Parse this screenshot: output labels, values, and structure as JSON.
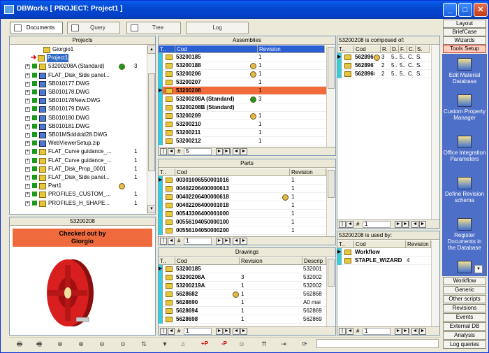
{
  "window": {
    "title": "DBWorks [ PROJECT: Project1 ]",
    "min": "_",
    "max": "□",
    "close": "✕"
  },
  "tabs": [
    {
      "label": "Documents",
      "active": true
    },
    {
      "label": "Query",
      "active": false
    },
    {
      "label": "Tree",
      "active": false
    },
    {
      "label": "Log",
      "active": false
    }
  ],
  "projects": {
    "header": "Projects",
    "tree": [
      {
        "label": "Giorgio1",
        "icon": "folder-icon",
        "level": 0,
        "count": "",
        "status": ""
      },
      {
        "label": "Project1",
        "icon": "folder-icon",
        "level": 0,
        "count": "",
        "status": "",
        "selected": true
      },
      {
        "label": "53200208A (Standard)",
        "icon": "assembly-icon",
        "level": 1,
        "count": "3",
        "status": "green"
      },
      {
        "label": "FLAT_Disk_Side panel...",
        "icon": "document-icon",
        "level": 1,
        "count": "",
        "status": ""
      },
      {
        "label": "SB010177.DWG",
        "icon": "drawing-icon",
        "level": 1,
        "count": "",
        "status": ""
      },
      {
        "label": "SB010178.DWG",
        "icon": "drawing-icon",
        "level": 1,
        "count": "",
        "status": ""
      },
      {
        "label": "SB010178New.DWG",
        "icon": "drawing-icon",
        "level": 1,
        "count": "",
        "status": ""
      },
      {
        "label": "SB010179.DWG",
        "icon": "drawing-icon",
        "level": 1,
        "count": "",
        "status": ""
      },
      {
        "label": "SB010180.DWG",
        "icon": "drawing-icon",
        "level": 1,
        "count": "",
        "status": ""
      },
      {
        "label": "SB010181.DWG",
        "icon": "drawing-icon",
        "level": 1,
        "count": "",
        "status": ""
      },
      {
        "label": "SB01MSddddd28.DWG",
        "icon": "drawing-icon",
        "level": 1,
        "count": "",
        "status": ""
      },
      {
        "label": "WebViewerSetup.zip",
        "icon": "zip-icon",
        "level": 1,
        "count": "",
        "status": ""
      },
      {
        "label": "FLAT_Curve guidance_...",
        "icon": "part-icon",
        "level": 1,
        "count": "1",
        "status": ""
      },
      {
        "label": "FLAT_Curve guidance_...",
        "icon": "part-icon",
        "level": 1,
        "count": "1",
        "status": ""
      },
      {
        "label": "FLAT_Disk_Prop_0001",
        "icon": "part-icon",
        "level": 1,
        "count": "1",
        "status": ""
      },
      {
        "label": "FLAT_Disk_Side panel...",
        "icon": "part-icon",
        "level": 1,
        "count": "1",
        "status": ""
      },
      {
        "label": "Part1",
        "icon": "part-icon",
        "level": 1,
        "count": "",
        "status": "orange"
      },
      {
        "label": "PROFILES_CUSTOM_...",
        "icon": "part-icon",
        "level": 1,
        "count": "1",
        "status": ""
      },
      {
        "label": "PROFILES_H_SHAPE...",
        "icon": "part-icon",
        "level": 1,
        "count": "1",
        "status": ""
      }
    ]
  },
  "preview": {
    "header": "53200208",
    "checked_out": "Checked out by\nGiorgio"
  },
  "assemblies": {
    "header": "Assemblies",
    "columns": [
      "T..",
      "Cod",
      "Revision"
    ],
    "rows": [
      {
        "cod": "53200185",
        "rev": "1",
        "status": ""
      },
      {
        "cod": "53200188",
        "rev": "1",
        "status": "orange"
      },
      {
        "cod": "53200206",
        "rev": "1",
        "status": "orange"
      },
      {
        "cod": "53200207",
        "rev": "1",
        "status": ""
      },
      {
        "cod": "53200208",
        "rev": "1",
        "status": "",
        "selected": true
      },
      {
        "cod": "53200208A (Standard)",
        "rev": "3",
        "status": "green"
      },
      {
        "cod": "53200208B (Standard)",
        "rev": "",
        "status": ""
      },
      {
        "cod": "53200209",
        "rev": "1",
        "status": "orange"
      },
      {
        "cod": "53200210",
        "rev": "1",
        "status": ""
      },
      {
        "cod": "53200211",
        "rev": "1",
        "status": ""
      },
      {
        "cod": "53200212",
        "rev": "1",
        "status": ""
      }
    ],
    "nav_count": "5"
  },
  "parts": {
    "header": "Parts",
    "columns": [
      "T..",
      "Cod",
      "Revision"
    ],
    "rows": [
      {
        "cod": "00301006550001016",
        "rev": "1",
        "status": ""
      },
      {
        "cod": "00402206400000613",
        "rev": "1",
        "status": ""
      },
      {
        "cod": "00402206400000618",
        "rev": "1",
        "status": "orange"
      },
      {
        "cod": "00402206400001018",
        "rev": "1",
        "status": ""
      },
      {
        "cod": "00543306400001000",
        "rev": "1",
        "status": ""
      },
      {
        "cod": "00556104050000100",
        "rev": "1",
        "status": ""
      },
      {
        "cod": "00556104050000200",
        "rev": "1",
        "status": ""
      }
    ],
    "nav_count": "1"
  },
  "drawings": {
    "header": "Drawings",
    "columns": [
      "T..",
      "Cod",
      "Revision",
      "Descrip"
    ],
    "rows": [
      {
        "cod": "53200185",
        "rev": "",
        "desc": "532001",
        "status": ""
      },
      {
        "cod": "53200208A",
        "rev": "3",
        "desc": "532002",
        "status": ""
      },
      {
        "cod": "53200219A",
        "rev": "1",
        "desc": "532002",
        "status": ""
      },
      {
        "cod": "5628682",
        "rev": "1",
        "desc": "562868",
        "status": "orange"
      },
      {
        "cod": "5628690",
        "rev": "1",
        "desc": "A0 mai",
        "status": ""
      },
      {
        "cod": "5628694",
        "rev": "1",
        "desc": "562869",
        "status": ""
      },
      {
        "cod": "5628698",
        "rev": "1",
        "desc": "562869",
        "status": ""
      }
    ],
    "nav_count": "1"
  },
  "composed": {
    "header": "53200208 is composed of:",
    "columns": [
      "T..",
      "Cod",
      "R.",
      "D.",
      "F.",
      "C.",
      "S."
    ],
    "rows": [
      {
        "cod": "562896",
        "r": "3",
        "d": "5..",
        "f": "5..",
        "c": "C.",
        "s": "S."
      },
      {
        "cod": "5628967",
        "r": "2",
        "d": "5..",
        "f": "5..",
        "c": "C.",
        "s": "S."
      },
      {
        "cod": "5628968",
        "r": "2",
        "d": "5..",
        "f": "5..",
        "c": "C.",
        "s": "S."
      }
    ],
    "nav_count": "1"
  },
  "usedby": {
    "header": "53200208 is used by:",
    "columns": [
      "T..",
      "Cod",
      "Revision"
    ],
    "rows": [
      {
        "cod": "Workflow",
        "rev": ""
      },
      {
        "cod": "STAPLE_WIZARD",
        "rev": "4"
      }
    ],
    "nav_count": "1"
  },
  "sidebar_top": [
    "Layout",
    "BriefCase",
    "Wizards",
    "Tools Setup"
  ],
  "sidebar_links": [
    "Edit Material Database",
    "Custom Property Manager",
    "Office Integration Parameters",
    "Define Revision schema",
    "Register Documents in the Database"
  ],
  "sidebar_bottom": [
    "Workflow",
    "Generic",
    "Other scripts",
    "Revisions",
    "Events",
    "External DB",
    "Analysis",
    "Log queries"
  ],
  "toolbar": {
    "plus_p": "+P",
    "minus_p": "-P"
  },
  "nav": {
    "hash": "#"
  },
  "colors": {
    "title_bar": "#0447d0",
    "selection": "#f26b3a",
    "sidebar_bg": "#4d6fc8",
    "checked_out_bg": "#ef6b3e",
    "status_green": "#1a9a1a",
    "status_orange": "#e9b84a"
  }
}
